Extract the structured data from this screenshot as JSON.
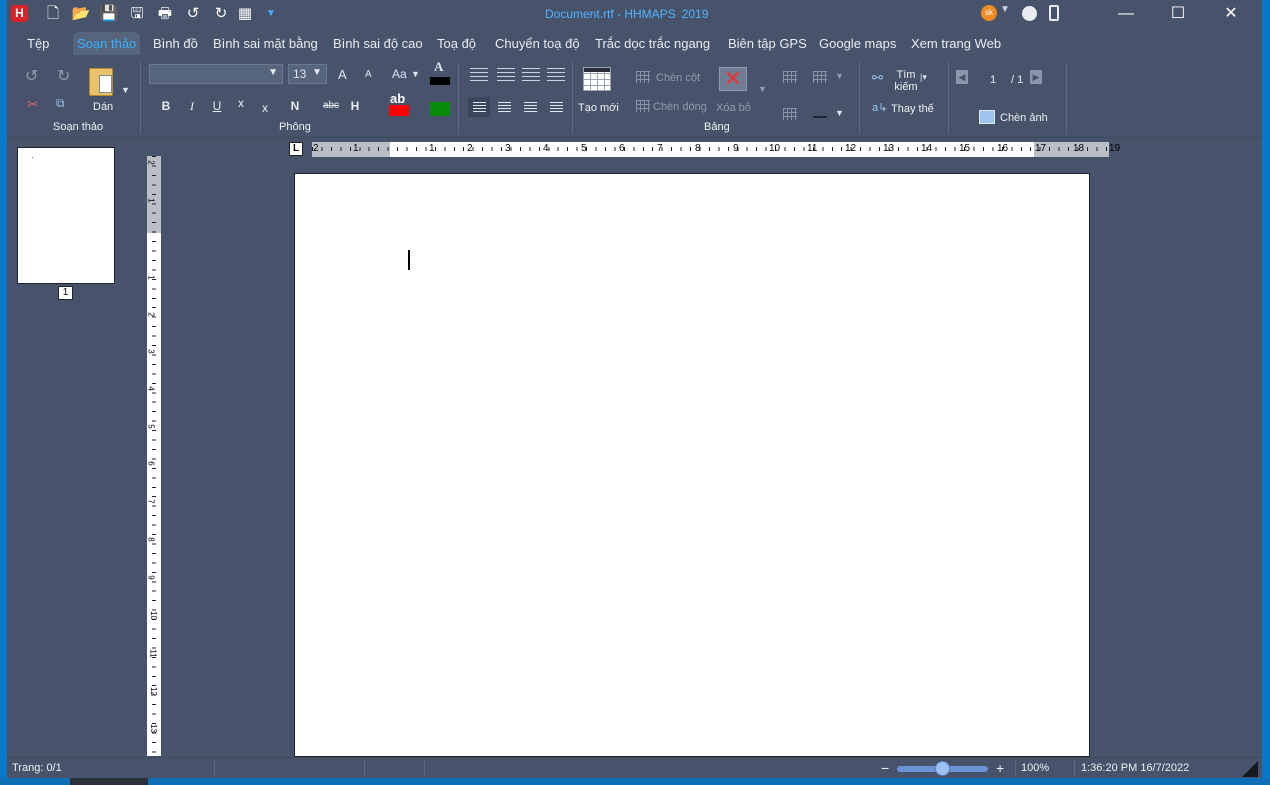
{
  "window": {
    "title_doc": "Document.rtf - HHMAPS",
    "title_year": "2019",
    "account_initials": "sk",
    "minimize": "—",
    "maximize": "☐",
    "close": "✕"
  },
  "quick_access": [
    "new-document-icon",
    "open-icon",
    "save-icon",
    "save-as-icon",
    "print-icon",
    "undo-icon",
    "redo-icon",
    "calculator-icon",
    "customize-icon"
  ],
  "menu": {
    "items": [
      "Tệp",
      "Soạn thảo",
      "Bình đồ",
      "Bình sai mặt bằng",
      "Bình sai độ cao",
      "Toạ độ",
      "Chuyển toạ độ",
      "Trắc dọc trắc ngang",
      "Biên tập GPS",
      "Google maps",
      "Xem trang Web"
    ],
    "active": "Soạn thảo"
  },
  "ribbon": {
    "soan_thao": {
      "label": "Soạn thảo",
      "paste": "Dán"
    },
    "phong": {
      "label": "Phông",
      "font_name": "",
      "font_size": "13",
      "grow": "A",
      "shrink": "A",
      "case": "Aa",
      "font_color_glyph": "A",
      "bold": "B",
      "italic": "I",
      "underline": "U",
      "subscript": "x",
      "superscript": "x",
      "normal": "N",
      "strike": "abc",
      "heading": "H",
      "highlight_glyph": "ab",
      "font_color": "#000000",
      "highlight_color": "#ff0000",
      "shade_color": "#0a8a0a"
    },
    "bang": {
      "label": "Bảng",
      "new_table": "Tạo mới",
      "insert_column": "Chèn cột",
      "insert_row": "Chèn dòng",
      "delete": "Xóa bỏ"
    },
    "tim": {
      "search": "Tìm kiếm",
      "replace": "Thay thế",
      "page_current": "1",
      "page_total": "/ 1",
      "insert_image": "Chèn ảnh"
    }
  },
  "thumbnail": {
    "page_number": "1"
  },
  "ruler": {
    "h_labels": [
      "2",
      "1",
      "1",
      "2",
      "3",
      "4",
      "5",
      "6",
      "7",
      "8",
      "9",
      "10",
      "11",
      "12",
      "13",
      "14",
      "15",
      "16",
      "17",
      "18",
      "19"
    ],
    "v_labels": [
      "2",
      "1",
      "1",
      "2",
      "3",
      "4",
      "5",
      "6",
      "7",
      "8",
      "9",
      "10",
      "11",
      "12",
      "13"
    ],
    "tab_stop": "L"
  },
  "status": {
    "page": "Trang: 0/1",
    "zoom_out": "−",
    "zoom_in": "+",
    "zoom_level": "100%",
    "zoom_fraction": 0.5,
    "datetime": "1:36:20 PM 16/7/2022"
  }
}
